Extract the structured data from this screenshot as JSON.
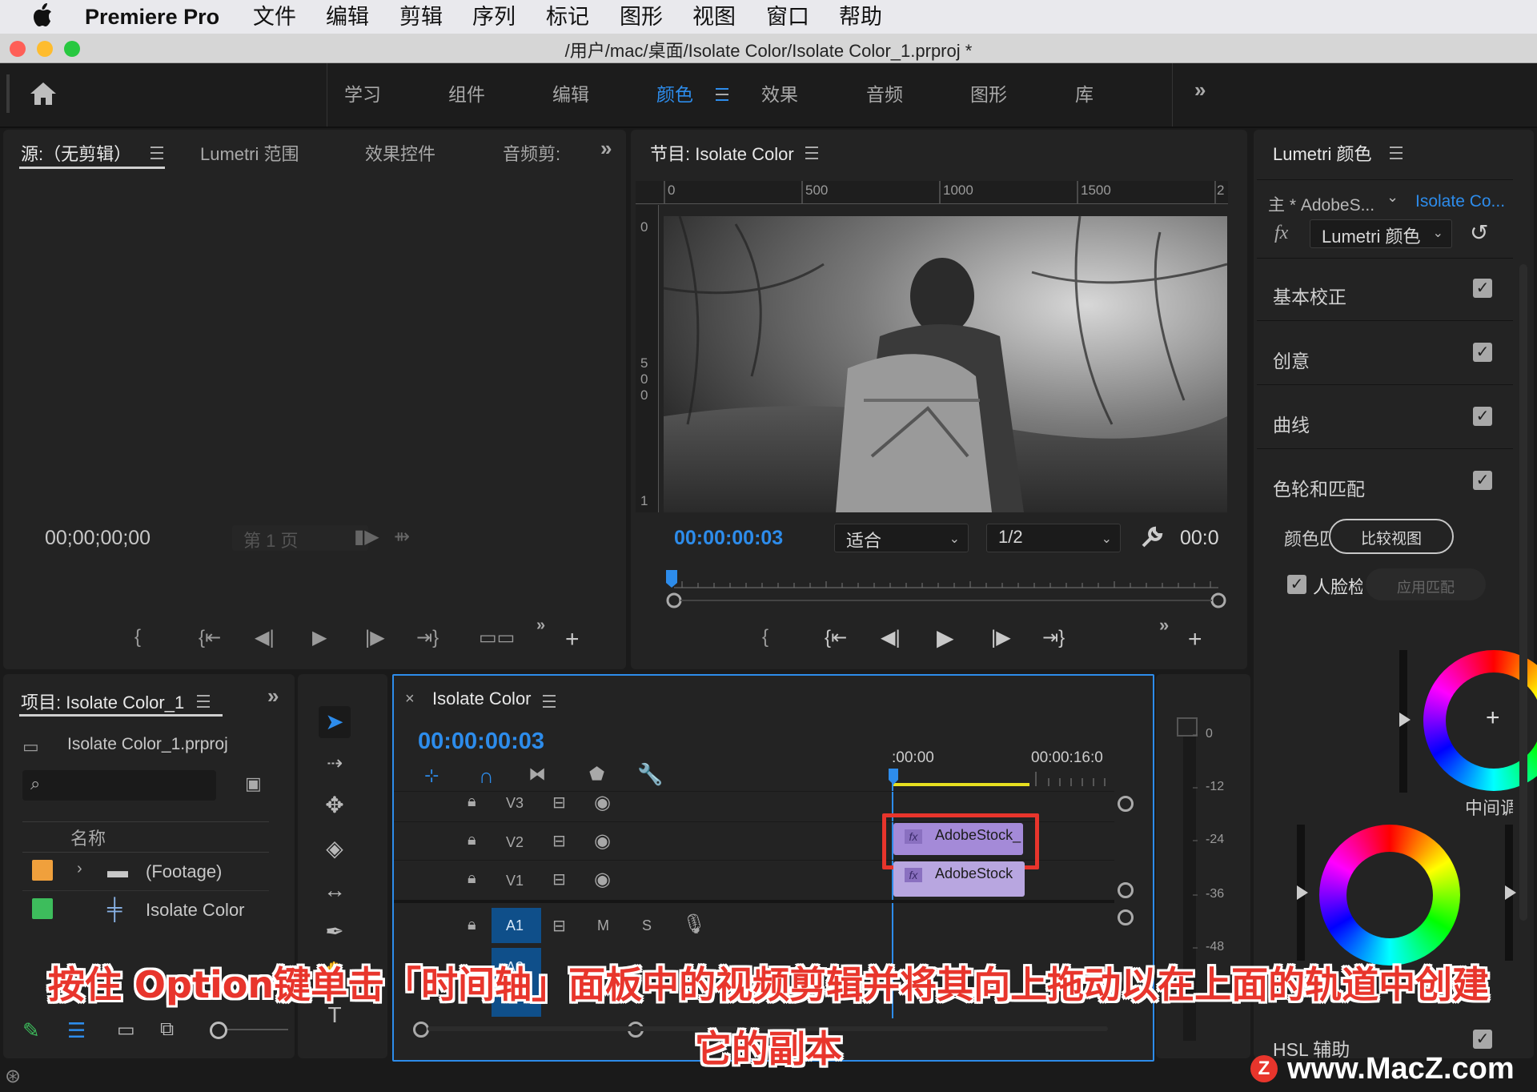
{
  "menubar": {
    "app": "Premiere Pro",
    "items": [
      "文件",
      "编辑",
      "剪辑",
      "序列",
      "标记",
      "图形",
      "视图",
      "窗口",
      "帮助"
    ]
  },
  "window": {
    "title": "/用户/mac/桌面/Isolate Color/Isolate Color_1.prproj *"
  },
  "workspaces": {
    "tabs": [
      "学习",
      "组件",
      "编辑",
      "颜色",
      "效果",
      "音频",
      "图形",
      "库"
    ],
    "active": "颜色"
  },
  "source_panel": {
    "tabs": [
      "源:（无剪辑）",
      "Lumetri 范围",
      "效果控件",
      "音频剪:"
    ],
    "timecode": "00;00;00;00",
    "page": "第 1 页"
  },
  "program_panel": {
    "title": "节目: Isolate Color",
    "ruler_h": [
      "0",
      "500",
      "1000",
      "1500",
      "2"
    ],
    "ruler_v": [
      "0",
      "5",
      "0",
      "0",
      "1"
    ],
    "timecode": "00:00:00:03",
    "fit": "适合",
    "resolution": "1/2",
    "timecode_right": "00:0"
  },
  "lumetri": {
    "title": "Lumetri 颜色",
    "master": "主 * AdobeS...",
    "clip": "Isolate Co...",
    "effect": "Lumetri 颜色",
    "sections": [
      "基本校正",
      "创意",
      "曲线",
      "色轮和匹配"
    ],
    "color_label": "颜色匹",
    "compare_button": "比较视图",
    "face_label": "人脸检",
    "apply_button": "应用匹配",
    "midtone_label": "中间调",
    "hsl": "HSL 辅助"
  },
  "project_panel": {
    "title": "项目: Isolate Color_1",
    "file": "Isolate Color_1.prproj",
    "column": "名称",
    "items": [
      {
        "name": "(Footage)",
        "color": "#f0a03c",
        "kind": "folder"
      },
      {
        "name": "Isolate Color",
        "color": "#3dbd5c",
        "kind": "sequence"
      }
    ]
  },
  "timeline": {
    "title": "Isolate Color",
    "timecode": "00:00:00:03",
    "ruler": [
      ":00:00",
      "00:00:16:0"
    ],
    "tracks": [
      "V3",
      "V2",
      "V1",
      "A1",
      "A2"
    ],
    "track_buttons": [
      "M",
      "S"
    ],
    "clips": [
      {
        "track": "V2",
        "name": "AdobeStock_",
        "highlighted": true
      },
      {
        "track": "V1",
        "name": "AdobeStock"
      }
    ]
  },
  "meter": {
    "labels": [
      "0",
      "-12",
      "-24",
      "-36",
      "-48"
    ]
  },
  "caption": {
    "line1": "按住 Option键单击「时间轴」面板中的视频剪辑并将其向上拖动以在上面的轨道中创建",
    "line2": "它的副本"
  },
  "watermark": "www.MacZ.com",
  "colors": {
    "accent": "#2d8ceb",
    "clip": "#a48ad8",
    "highlight": "#e8352c"
  }
}
